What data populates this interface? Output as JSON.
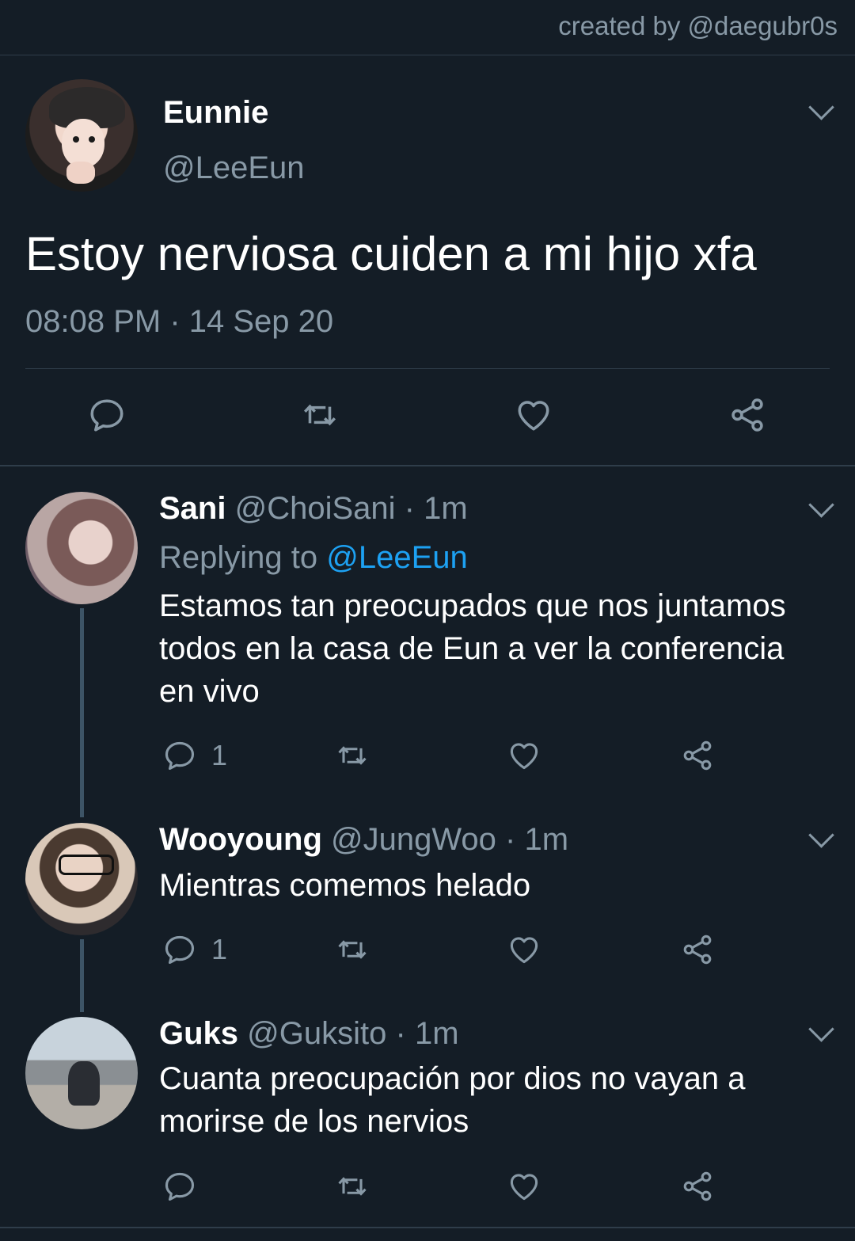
{
  "credit": "created by @daegubr0s",
  "main_tweet": {
    "name": "Eunnie",
    "handle": "@LeeEun",
    "text": "Estoy nerviosa cuiden a mi hijo xfa",
    "timestamp": "08:08 PM · 14 Sep 20"
  },
  "replies": [
    {
      "name": "Sani",
      "handle": "@ChoiSani",
      "time": "· 1m",
      "replying_prefix": "Replying to",
      "replying_to": "@LeeEun",
      "text": "Estamos tan preocupados que nos juntamos todos en la casa de Eun a ver la conferencia en vivo",
      "reply_count": "1"
    },
    {
      "name": "Wooyoung",
      "handle": "@JungWoo",
      "time": "· 1m",
      "text": "Mientras comemos helado",
      "reply_count": "1"
    },
    {
      "name": "Guks",
      "handle": "@Guksito",
      "time": "· 1m",
      "text": "Cuanta preocupación por dios no vayan a morirse de los nervios"
    }
  ],
  "icons": [
    "reply-icon",
    "retweet-icon",
    "like-icon",
    "share-icon",
    "chevron-down-icon"
  ],
  "colors": {
    "background": "#141d26",
    "secondary_text": "#8899a6",
    "link": "#1da1f2",
    "divider": "#2f3d4a"
  }
}
